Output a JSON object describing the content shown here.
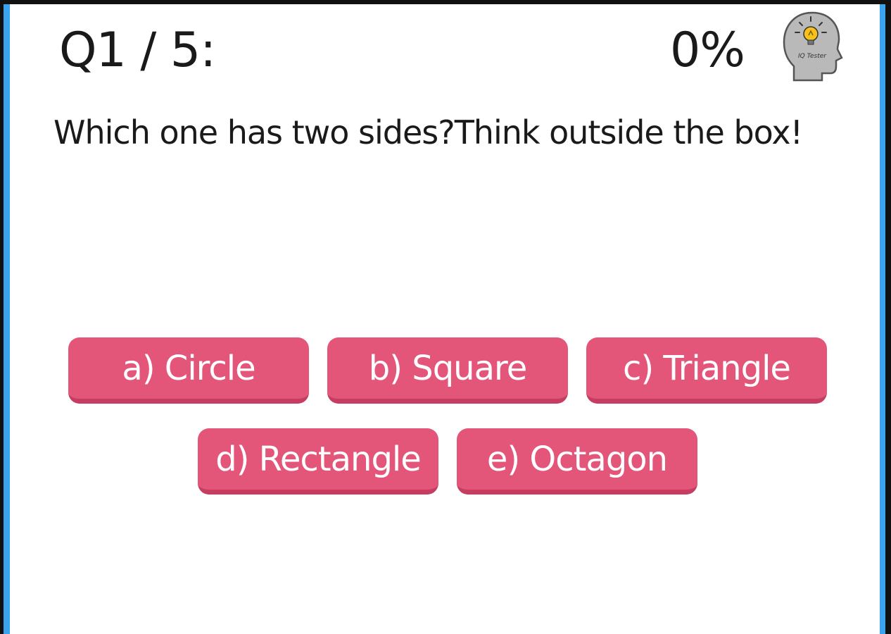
{
  "quiz": {
    "counter": "Q1 / 5:",
    "score": "0%",
    "logo_text": "IQ Tester",
    "logo_icon": "head-lightbulb-icon",
    "question": "Which one has two sides?Think outside the box!",
    "answers": [
      {
        "label": "a) Circle"
      },
      {
        "label": "b) Square"
      },
      {
        "label": "c) Triangle"
      },
      {
        "label": "d) Rectangle"
      },
      {
        "label": "e) Octagon"
      }
    ]
  },
  "colors": {
    "frame_border": "#111111",
    "frame_accent": "#3aa5ee",
    "answer_button": "#e4557a",
    "answer_button_shadow": "#c63d61",
    "text": "#1a1a1a"
  }
}
